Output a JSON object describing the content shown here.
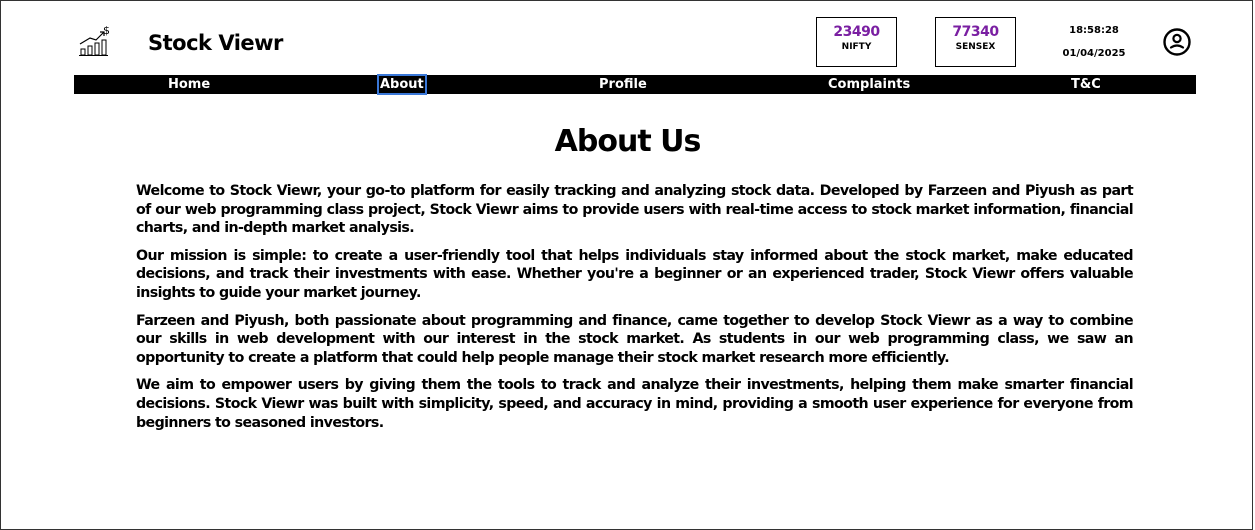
{
  "header": {
    "app_name": "Stock Viewr",
    "logo_icon": "stock-growth-chart-icon",
    "profile_icon": "user-circle-icon"
  },
  "tickers": [
    {
      "value": "23490",
      "name": "NIFTY"
    },
    {
      "value": "77340",
      "name": "SENSEX"
    }
  ],
  "clock": {
    "time": "18:58:28",
    "date": "01/04/2025"
  },
  "nav": {
    "items": [
      "Home",
      "About",
      "Profile",
      "Complaints",
      "T&C"
    ],
    "active": "About"
  },
  "main": {
    "title": "About Us",
    "paragraphs": [
      "Welcome to Stock Viewr, your go-to platform for easily tracking and analyzing stock data. Developed by Farzeen and Piyush as part of our web programming class project, Stock Viewr aims to provide users with real-time access to stock market information, financial charts, and in-depth market analysis.",
      "Our mission is simple: to create a user-friendly tool that helps individuals stay informed about the stock market, make educated decisions, and track their investments with ease. Whether you're a beginner or an experienced trader, Stock Viewr offers valuable insights to guide your market journey.",
      "Farzeen and Piyush, both passionate about programming and finance, came together to develop Stock Viewr as a way to combine our skills in web development with our interest in the stock market. As students in our web programming class, we saw an opportunity to create a platform that could help people manage their stock market research more efficiently.",
      "We aim to empower users by giving them the tools to track and analyze their investments, helping them make smarter financial decisions. Stock Viewr was built with simplicity, speed, and accuracy in mind, providing a smooth user experience for everyone from beginners to seasoned investors."
    ]
  },
  "colors": {
    "ticker_value": "#7a1fa2",
    "nav_background": "#000000",
    "nav_active_outline": "#3a78d8"
  }
}
